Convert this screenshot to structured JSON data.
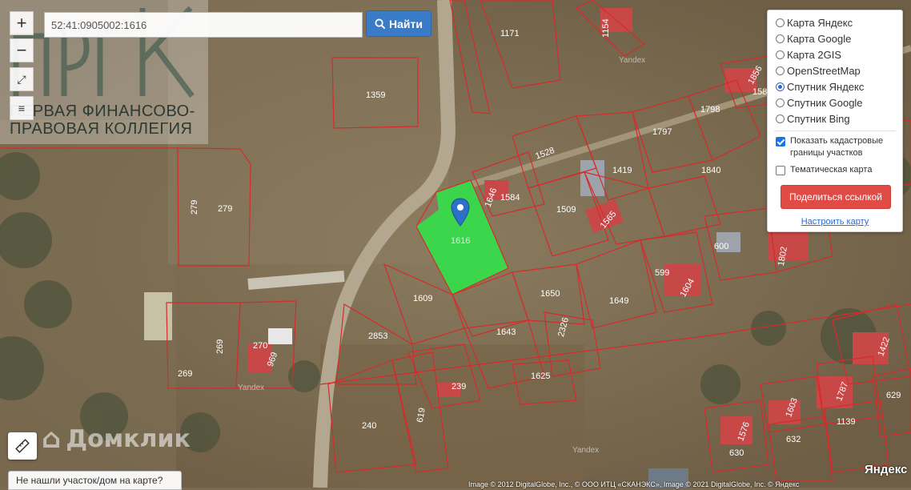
{
  "search": {
    "value": "52:41:0905002:1616",
    "button_label": "Найти"
  },
  "zoom": {
    "plus": "+",
    "minus": "−"
  },
  "logo": {
    "monogram": "ПФПК",
    "line1": "ПЕРВАЯ ФИНАНСОВО-",
    "line2": "ПРАВОВАЯ КОЛЛЕГИЯ"
  },
  "layers": {
    "options": [
      "Карта Яндекс",
      "Карта Google",
      "Карта 2GIS",
      "OpenStreetMap",
      "Спутник Яндекс",
      "Спутник Google",
      "Спутник Bing"
    ],
    "selected": "Спутник Яндекс",
    "cadastral_label": "Показать кадастровые границы участков",
    "cadastral_checked": true,
    "thematic_label": "Тематическая карта",
    "thematic_checked": false,
    "share_label": "Поделиться ссылкой",
    "config_label": "Настроить карту"
  },
  "parcels": [
    "1171",
    "1154",
    "1359",
    "1856",
    "158",
    "1798",
    "1797",
    "1528",
    "1840",
    "1419",
    "1646",
    "1584",
    "1509",
    "1565",
    "279",
    "1616",
    "600",
    "1802",
    "599",
    "1604",
    "1609",
    "1650",
    "1649",
    "2853",
    "1643",
    "2326",
    "270",
    "269",
    "969",
    "1625",
    "239",
    "1422",
    "1787",
    "629",
    "240",
    "619",
    "1603",
    "1139",
    "1576",
    "632",
    "630"
  ],
  "map_watermarks": [
    "Yandex",
    "Yandex",
    "Yandex"
  ],
  "domclick_label": "Домклик",
  "yandex_logo": "Яндекс",
  "copyright": "Image © 2012 DigitalGlobe, Inc., © ООО ИТЦ «СКАНЭКС», Image © 2021 DigitalGlobe, Inc. © Яндекс",
  "not_found_label": "Не нашли участок/дом на карте?",
  "colors": {
    "highlight_parcel": "#33e04a",
    "boundary": "#d62b2b",
    "search_button": "#3a7bc8",
    "share_button": "#e04b45"
  }
}
